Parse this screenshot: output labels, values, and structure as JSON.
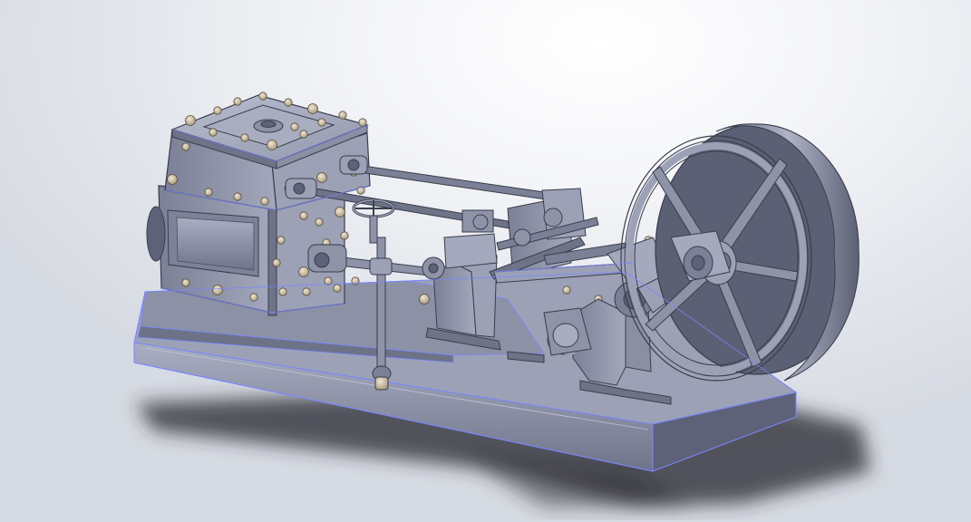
{
  "viewport": {
    "background_top": "#ffffff",
    "background_bottom": "#d6dae2"
  },
  "model": {
    "body_color": "#8e93a8",
    "body_light": "#a9aec2",
    "body_dark": "#5e6278",
    "edge_color": "#3a3d4c",
    "highlight_edge": "#7a86ff",
    "fastener_color": "#cbbfa8",
    "shadow_color": "#2b2d33",
    "parts": [
      "base-plate",
      "cylinder-block",
      "valve-chest",
      "piston-rods",
      "valve-wheel",
      "governor-rod",
      "crosshead-guides",
      "connecting-rod",
      "crankshaft-bearing",
      "flywheel",
      "eccentric"
    ]
  }
}
